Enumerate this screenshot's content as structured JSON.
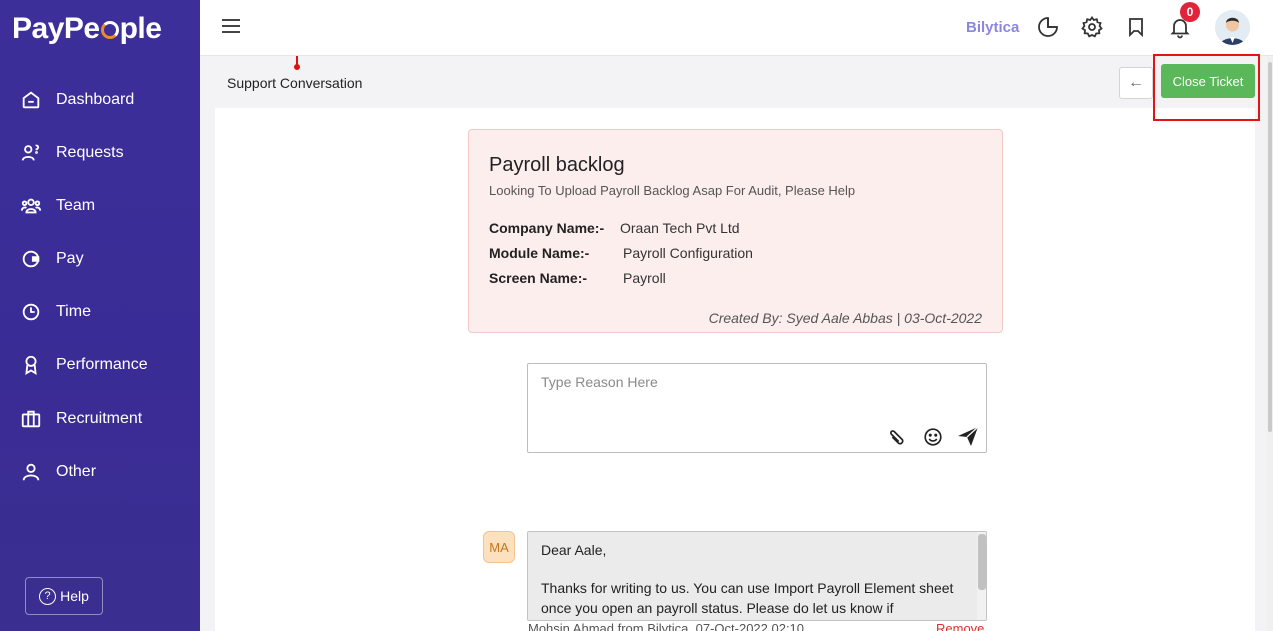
{
  "brand": {
    "name_prefix": "PayPe",
    "name_suffix": "ple"
  },
  "sidebar": {
    "items": [
      {
        "label": "Dashboard",
        "icon": "home-icon"
      },
      {
        "label": "Requests",
        "icon": "user-question-icon"
      },
      {
        "label": "Team",
        "icon": "team-icon"
      },
      {
        "label": "Pay",
        "icon": "wallet-icon"
      },
      {
        "label": "Time",
        "icon": "clock-icon"
      },
      {
        "label": "Performance",
        "icon": "award-icon"
      },
      {
        "label": "Recruitment",
        "icon": "briefcase-icon"
      },
      {
        "label": "Other",
        "icon": "user-icon"
      }
    ],
    "help_label": "Help"
  },
  "topbar": {
    "company": "Bilytica",
    "notification_count": "0"
  },
  "page": {
    "title": "Support Conversation",
    "close_button": "Close Ticket",
    "back_arrow": "←"
  },
  "ticket": {
    "title": "Payroll backlog",
    "description": "Looking To Upload Payroll Backlog Asap For Audit, Please Help",
    "company_label": "Company Name:-",
    "company_value": "Oraan Tech Pvt Ltd",
    "module_label": "Module Name:-",
    "module_value": "Payroll Configuration",
    "screen_label": "Screen Name:-",
    "screen_value": "Payroll",
    "created_by": "Created By:  Syed Aale Abbas  |   03-Oct-2022"
  },
  "reply": {
    "placeholder": "Type Reason Here"
  },
  "messages": [
    {
      "initials": "MA",
      "greeting": "Dear Aale,",
      "body": "Thanks for writing to us. You can use Import Payroll Element sheet once you open an payroll status. Please do let us know if",
      "meta": "Mohsin Ahmad from Bilytica, 07-Oct-2022 02:10",
      "remove_label": "Remove"
    }
  ],
  "colors": {
    "sidebar": "#3d2f9a",
    "accent_green": "#5bb85a",
    "card_bg": "#fdeeee",
    "highlight": "#e41212"
  }
}
